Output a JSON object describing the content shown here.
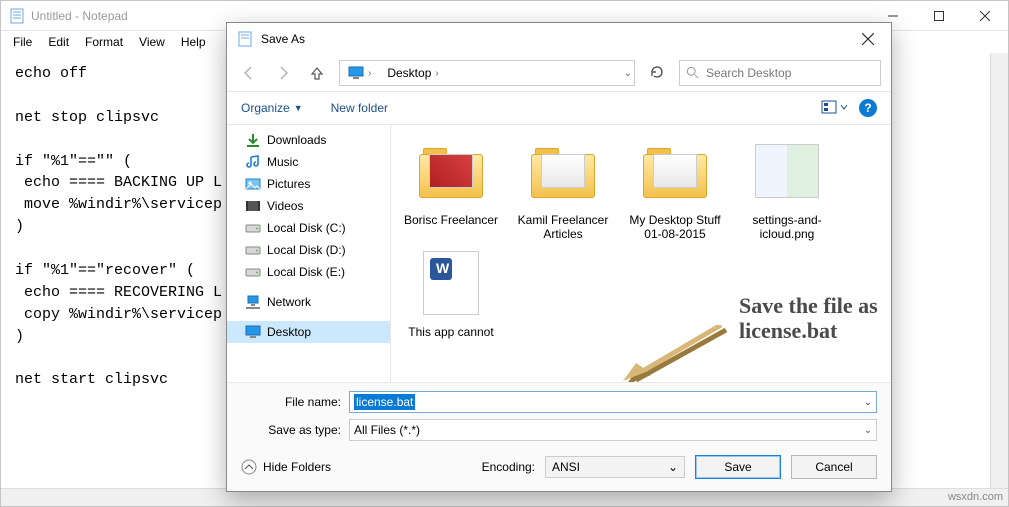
{
  "notepad": {
    "title": "Untitled - Notepad",
    "menus": [
      "File",
      "Edit",
      "Format",
      "View",
      "Help"
    ],
    "content": "echo off\n\nnet stop clipsvc\n\nif \"%1\"==\"\" (\n echo ==== BACKING UP L\n move %windir%\\servicep                                                                                         files\\locals\n)\n\nif \"%1\"==\"recover\" (\n echo ==== RECOVERING L\n copy %windir%\\servicep                                                                                         files\\locals\n)\n\nnet start clipsvc"
  },
  "saveas": {
    "title": "Save As",
    "breadcrumb_root_icon": "monitor",
    "breadcrumb": "Desktop",
    "search_placeholder": "Search Desktop",
    "organize": "Organize",
    "new_folder": "New folder",
    "tree": [
      {
        "icon": "download",
        "label": "Downloads"
      },
      {
        "icon": "music",
        "label": "Music"
      },
      {
        "icon": "pictures",
        "label": "Pictures"
      },
      {
        "icon": "videos",
        "label": "Videos"
      },
      {
        "icon": "disk",
        "label": "Local Disk (C:)"
      },
      {
        "icon": "disk",
        "label": "Local Disk (D:)"
      },
      {
        "icon": "disk",
        "label": "Local Disk (E:)"
      },
      {
        "icon": "network",
        "label": "Network"
      },
      {
        "icon": "desktop",
        "label": "Desktop",
        "selected": true
      }
    ],
    "files": [
      {
        "type": "folder-img",
        "label": "Borisc Freelancer"
      },
      {
        "type": "folder",
        "label": "Kamil Freelancer Articles"
      },
      {
        "type": "folder",
        "label": "My Desktop Stuff 01-08-2015"
      },
      {
        "type": "image",
        "label": "settings-and-icloud.png"
      },
      {
        "type": "doc",
        "label": "This app cannot"
      }
    ],
    "annotation": "Save the file as\nlicense.bat",
    "filename_label": "File name:",
    "filename_value": "license.bat",
    "savetype_label": "Save as type:",
    "savetype_value": "All Files  (*.*)",
    "hide_folders": "Hide Folders",
    "encoding_label": "Encoding:",
    "encoding_value": "ANSI",
    "save_btn": "Save",
    "cancel_btn": "Cancel"
  },
  "watermark": "wsxdn.com"
}
